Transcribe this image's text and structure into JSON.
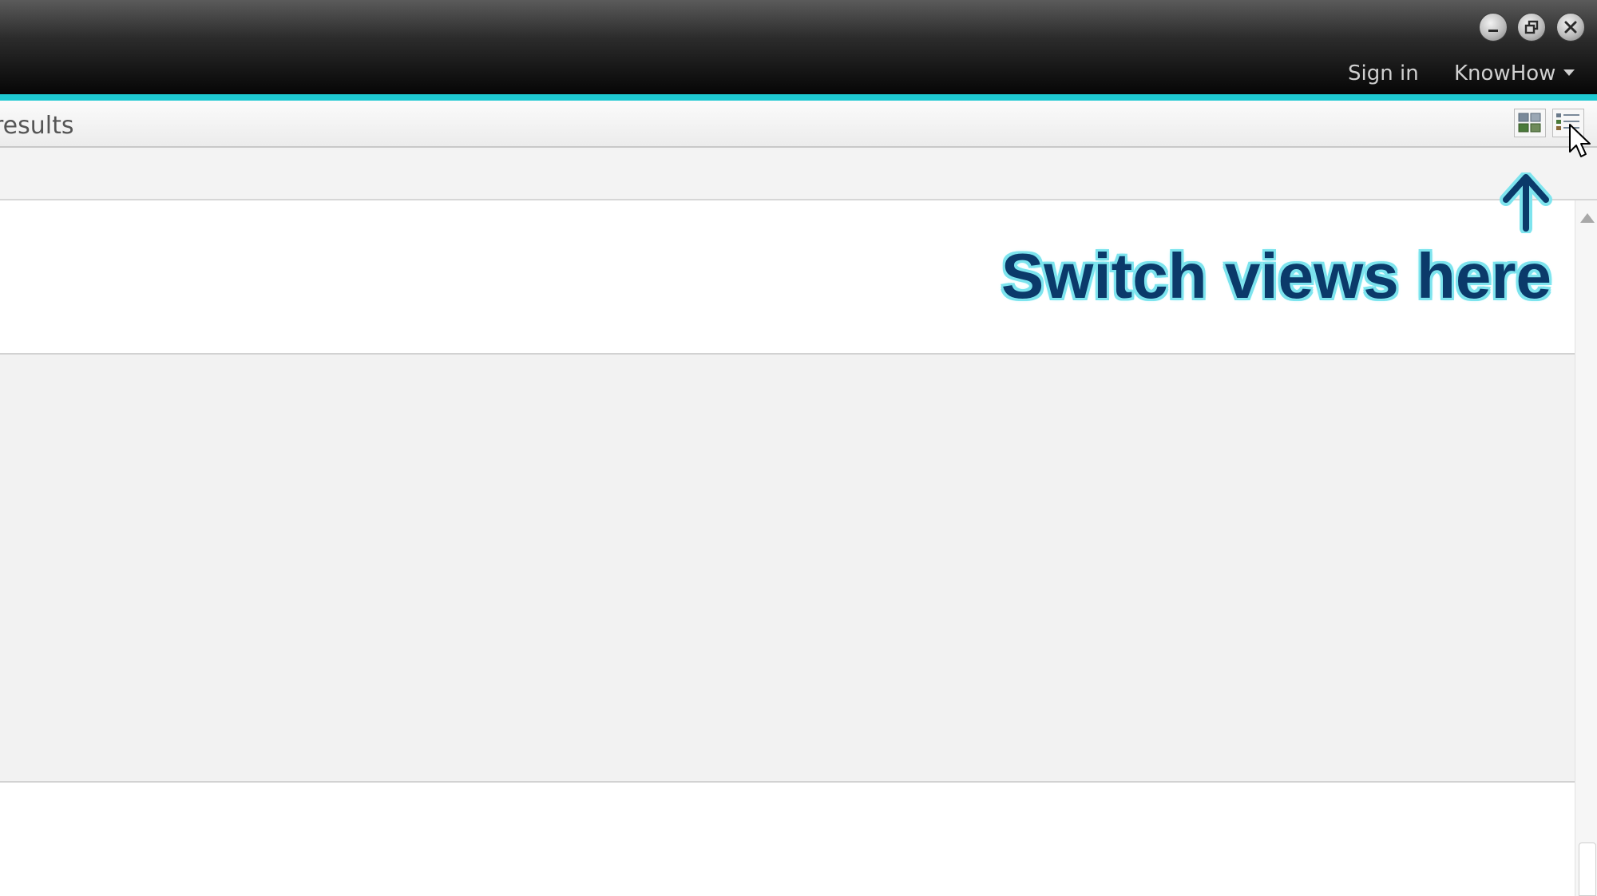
{
  "header": {
    "sign_in": "Sign in",
    "account_menu": "KnowHow",
    "accent_color": "#1ec9d2",
    "window_controls": [
      "minimize-icon",
      "restore-icon",
      "close-icon"
    ]
  },
  "toolbar": {
    "results_label": "results",
    "view_buttons": [
      "grid-view-icon",
      "list-view-icon"
    ]
  },
  "annotation": {
    "text": "Switch views here",
    "arrow": "arrow-up-icon",
    "text_color": "#0b3a6a",
    "glow_color": "#7ee4ee"
  }
}
